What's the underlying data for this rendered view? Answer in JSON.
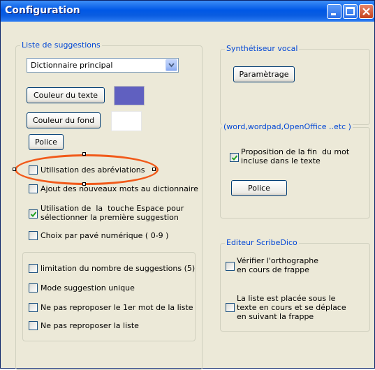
{
  "window": {
    "title": "Configuration",
    "controls": [
      "minimize-icon",
      "maximize-icon",
      "close-icon"
    ]
  },
  "suggestions": {
    "legend": "Liste de suggestions",
    "dictionary_select": "Dictionnaire principal",
    "text_color_button": "Couleur du texte",
    "text_color": "#6060c0",
    "bg_color_button": "Couleur du fond",
    "bg_color": "#ffffff",
    "font_button": "Police",
    "options": [
      {
        "label": "Utilisation des abréviations",
        "checked": false
      },
      {
        "label": "Ajout des nouveaux mots au dictionnaire",
        "checked": false
      },
      {
        "label": "Utilisation de  la  touche Espace pour\nsélectionner la première suggestion",
        "checked": true
      },
      {
        "label": "Choix par pavé numérique ( 0-9 )",
        "checked": false
      }
    ],
    "sub_options": [
      {
        "label": "limitation du  nombre de suggestions (5)",
        "checked": false
      },
      {
        "label": "Mode suggestion unique",
        "checked": false
      },
      {
        "label": "Ne pas reproposer le 1er mot de la liste",
        "checked": false
      },
      {
        "label": "Ne pas reproposer la liste",
        "checked": false
      }
    ]
  },
  "synth": {
    "legend": "Synthétiseur vocal",
    "settings_button": "Paramètrage"
  },
  "apps": {
    "legend": "(word,wordpad,OpenOffice ..etc )",
    "option": {
      "label": "Proposition de la fin  du mot\nincluse dans le texte",
      "checked": true
    },
    "font_button": "Police"
  },
  "editor": {
    "legend": "Editeur ScribeDico",
    "options": [
      {
        "label": "Vérifier l'orthographe\nen cours de frappe",
        "checked": false
      },
      {
        "label": "La liste est placée sous le\ntexte en cours et se déplace\nen suivant la frappe",
        "checked": false
      }
    ]
  },
  "colors": {
    "accent": "#0046d5",
    "annotation": "#f15a1a",
    "check": "#21a121"
  }
}
